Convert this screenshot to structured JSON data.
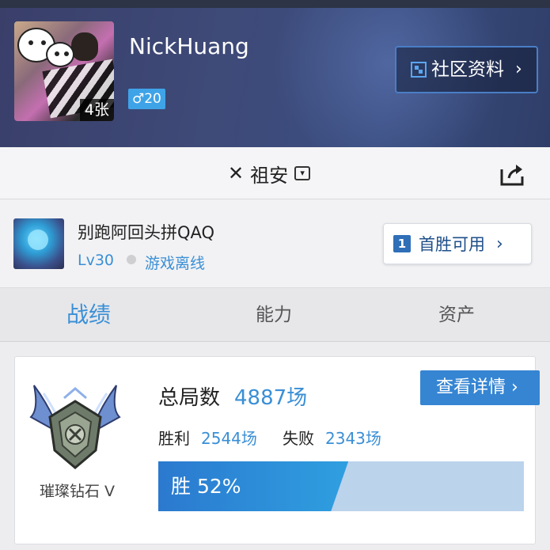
{
  "profile": {
    "nickname": "NickHuang",
    "photo_count": "4张",
    "gender_age": "♂20",
    "community_button": "社区资料"
  },
  "server": {
    "name": "祖安"
  },
  "summoner": {
    "name": "别跑阿回头拼QAQ",
    "level": "Lv30",
    "status": "游戏离线",
    "first_win_number": "1",
    "first_win_label": "首胜可用"
  },
  "tabs": [
    {
      "label": "战绩",
      "active": true
    },
    {
      "label": "能力",
      "active": false
    },
    {
      "label": "资产",
      "active": false
    }
  ],
  "stats": {
    "rank_name": "璀璨钻石 V",
    "total_label": "总局数",
    "total_value": "4887场",
    "wins_label": "胜利",
    "wins_value": "2544场",
    "losses_label": "失败",
    "losses_value": "2343场",
    "details_button": "查看详情",
    "win_rate_text": "胜 52%",
    "win_rate": 0.52
  },
  "colors": {
    "accent": "#3a8fd6",
    "header_bg": "#3e4a78",
    "button_blue": "#3585d3"
  }
}
